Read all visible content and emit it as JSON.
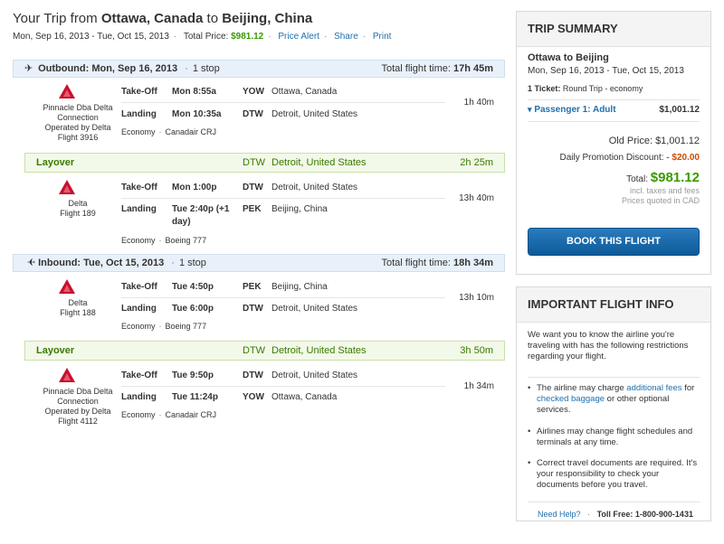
{
  "header": {
    "title_prefix": "Your Trip from ",
    "origin": "Ottawa, Canada",
    "title_to": " to ",
    "destination": "Beijing, China",
    "dates": "Mon, Sep 16, 2013 - Tue, Oct 15, 2013",
    "total_price_label": "Total Price:",
    "total_price": "$981.12",
    "price_alert": "Price Alert",
    "share": "Share",
    "print": "Print"
  },
  "outbound": {
    "plane_icon": "plane-right-icon",
    "title": "Outbound: Mon, Sep 16, 2013",
    "stops": "1 stop",
    "total_label": "Total flight time:",
    "total_time": "17h 45m"
  },
  "inbound": {
    "plane_icon": "plane-left-icon",
    "title": "Inbound: Tue, Oct 15, 2013",
    "stops": "1 stop",
    "total_label": "Total flight time:",
    "total_time": "18h 34m"
  },
  "labels": {
    "takeoff": "Take-Off",
    "landing": "Landing",
    "layover": "Layover"
  },
  "segments": [
    {
      "airline": "Pinnacle Dba Delta Connection",
      "operated": "Operated by Delta",
      "flight": "Flight 3916",
      "takeoff_time": "Mon 8:55a",
      "takeoff_code": "YOW",
      "takeoff_city": "Ottawa, Canada",
      "landing_time": "Mon 10:35a",
      "landing_code": "DTW",
      "landing_city": "Detroit, United States",
      "duration": "1h 40m",
      "cabin": "Economy",
      "aircraft": "Canadair CRJ"
    },
    {
      "airline": "Delta",
      "flight": "Flight 189",
      "takeoff_time": "Mon 1:00p",
      "takeoff_code": "DTW",
      "takeoff_city": "Detroit, United States",
      "landing_time": "Tue 2:40p (+1 day)",
      "landing_code": "PEK",
      "landing_city": "Beijing, China",
      "duration": "13h 40m",
      "cabin": "Economy",
      "aircraft": "Boeing 777"
    },
    {
      "airline": "Delta",
      "flight": "Flight 188",
      "takeoff_time": "Tue 4:50p",
      "takeoff_code": "PEK",
      "takeoff_city": "Beijing, China",
      "landing_time": "Tue 6:00p",
      "landing_code": "DTW",
      "landing_city": "Detroit, United States",
      "duration": "13h 10m",
      "cabin": "Economy",
      "aircraft": "Boeing 777"
    },
    {
      "airline": "Pinnacle Dba Delta Connection",
      "operated": "Operated by Delta",
      "flight": "Flight 4112",
      "takeoff_time": "Tue 9:50p",
      "takeoff_code": "DTW",
      "takeoff_city": "Detroit, United States",
      "landing_time": "Tue 11:24p",
      "landing_code": "YOW",
      "landing_city": "Ottawa, Canada",
      "duration": "1h 34m",
      "cabin": "Economy",
      "aircraft": "Canadair CRJ"
    }
  ],
  "layovers": [
    {
      "code": "DTW",
      "city": "Detroit, United States",
      "duration": "2h 25m"
    },
    {
      "code": "DTW",
      "city": "Detroit, United States",
      "duration": "3h 50m"
    }
  ],
  "summary": {
    "heading": "TRIP SUMMARY",
    "route": "Ottawa to Beijing",
    "dates": "Mon, Sep 16, 2013 - Tue, Oct 15, 2013",
    "ticket_label": "1 Ticket:",
    "ticket_type": "Round Trip - economy",
    "passenger": "Passenger 1: Adult",
    "passenger_price": "$1,001.12",
    "old_price_label": "Old Price:",
    "old_price": "$1,001.12",
    "discount_label": "Daily Promotion Discount:",
    "discount": "- $20.00",
    "total_label": "Total:",
    "total": "$981.12",
    "taxes_note": "incl. taxes and fees",
    "currency_note": "Prices quoted in CAD",
    "book_button": "BOOK THIS FLIGHT"
  },
  "info": {
    "heading": "IMPORTANT FLIGHT INFO",
    "intro": "We want you to know the airline you're traveling with has the following restrictions regarding your flight.",
    "b1_pre": "The airline may charge ",
    "b1_link1": "additional fees",
    "b1_mid": " for ",
    "b1_link2": "checked baggage",
    "b1_post": " or other optional services.",
    "b2": "Airlines may change flight schedules and terminals at any time.",
    "b3": "Correct travel documents are required. It's your responsibility to check your documents before you travel.",
    "help": "Need Help?",
    "toll_free": "Toll Free: 1-800-900-1431"
  },
  "colors": {
    "accent": "#1f6fae",
    "price_green": "#3a9a00",
    "discount_red": "#d04a00",
    "button_blue": "#1567ab",
    "delta_red": "#c8102e"
  }
}
